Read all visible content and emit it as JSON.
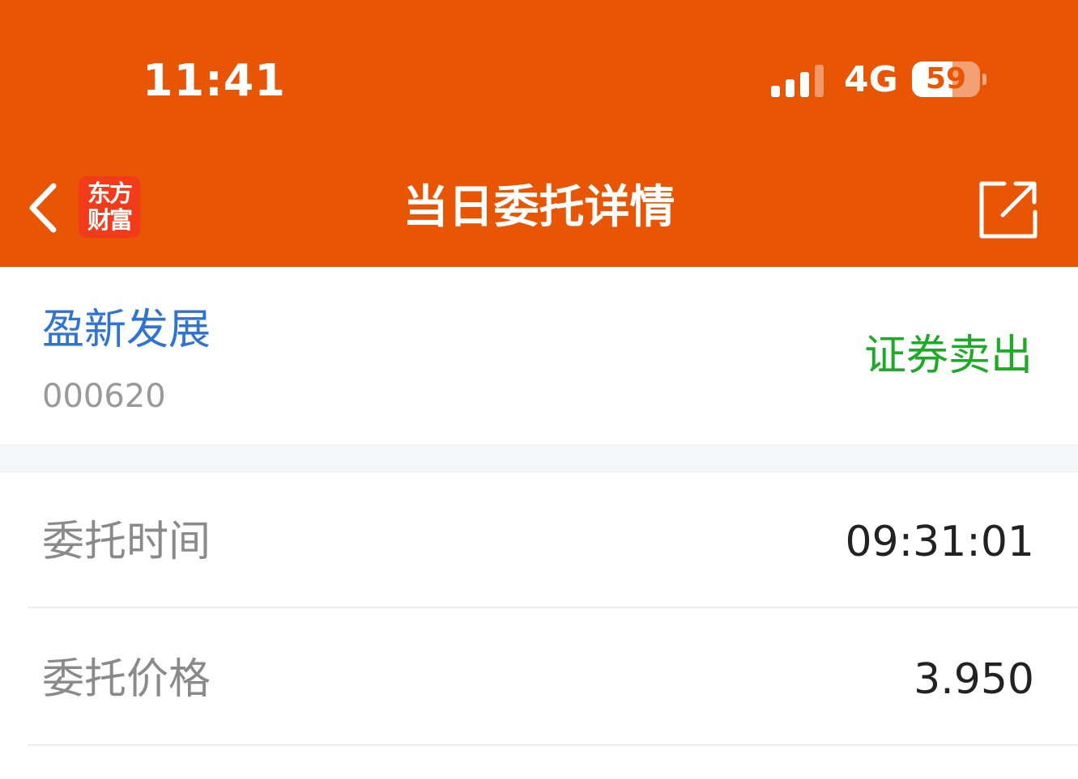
{
  "status_bar": {
    "time": "11:41",
    "network": "4G",
    "battery": "59",
    "battery_level": 0.59,
    "signal_bars_active": 3,
    "signal_bars_total": 4
  },
  "nav": {
    "title": "当日委托详情",
    "logo_line1": "东方",
    "logo_line2": "财富",
    "back_icon": "chevron-left-icon",
    "share_icon": "share-external-icon"
  },
  "stock": {
    "name": "盈新发展",
    "code": "000620",
    "trade_type": "证券卖出"
  },
  "details": [
    {
      "label": "委托时间",
      "value": "09:31:01"
    },
    {
      "label": "委托价格",
      "value": "3.950"
    }
  ],
  "colors": {
    "header_bg": "#E85504",
    "stock_name": "#2F73D4",
    "sell": "#1DAA24",
    "logo_bg": "#F23B1B"
  }
}
